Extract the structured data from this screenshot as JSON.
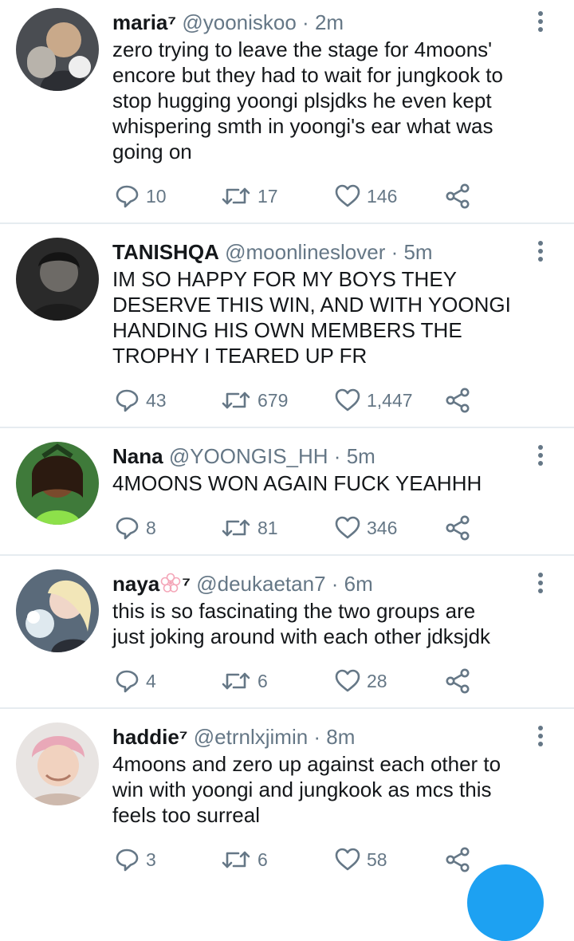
{
  "colors": {
    "text": "#14171a",
    "secondary": "#657786",
    "divider": "#e6ecf0",
    "accent": "#1da1f2"
  },
  "tweets": [
    {
      "name": "maria⁷",
      "handle": "@yooniskoo",
      "sep": " · ",
      "time": "2m",
      "text": "zero trying to leave the stage for 4moons'\nencore but they had to wait for jungkook to\nstop hugging yoongi plsjdks he even kept\nwhispering smth in yoongi's ear what was\ngoing on",
      "replies": "10",
      "retweets": "17",
      "likes": "146"
    },
    {
      "name": "TANISHQA",
      "handle": "@moonlineslover",
      "sep": " · ",
      "time": "5m",
      "text": "IM SO HAPPY FOR MY BOYS THEY\nDESERVE THIS WIN, AND WITH YOONGI\nHANDING HIS OWN MEMBERS THE\nTROPHY I TEARED UP FR",
      "replies": "43",
      "retweets": "679",
      "likes": "1,447"
    },
    {
      "name": "Nana",
      "handle": "@YOONGIS_HH",
      "sep": " · ",
      "time": "5m",
      "text": "4MOONS WON AGAIN FUCK YEAHHH",
      "replies": "8",
      "retweets": "81",
      "likes": "346"
    },
    {
      "name": "naya",
      "name_suffix": "⁷",
      "handle": "@deukaetan7",
      "sep": " · ",
      "time": "6m",
      "text": "this is so fascinating the two groups are\njust joking around with each other jdksjdk",
      "replies": "4",
      "retweets": "6",
      "likes": "28"
    },
    {
      "name": "haddie⁷",
      "handle": "@etrnlxjimin",
      "sep": " · ",
      "time": "8m",
      "text": "4moons and zero up against each other to\nwin with yoongi and jungkook as mcs this\nfeels too surreal",
      "replies": "3",
      "retweets": "6",
      "likes": "58"
    }
  ],
  "icons": {
    "reply": "reply-icon",
    "retweet": "retweet-icon",
    "like": "heart-icon",
    "share": "share-icon",
    "more": "more-vertical-icon",
    "compose": "compose-fab"
  }
}
